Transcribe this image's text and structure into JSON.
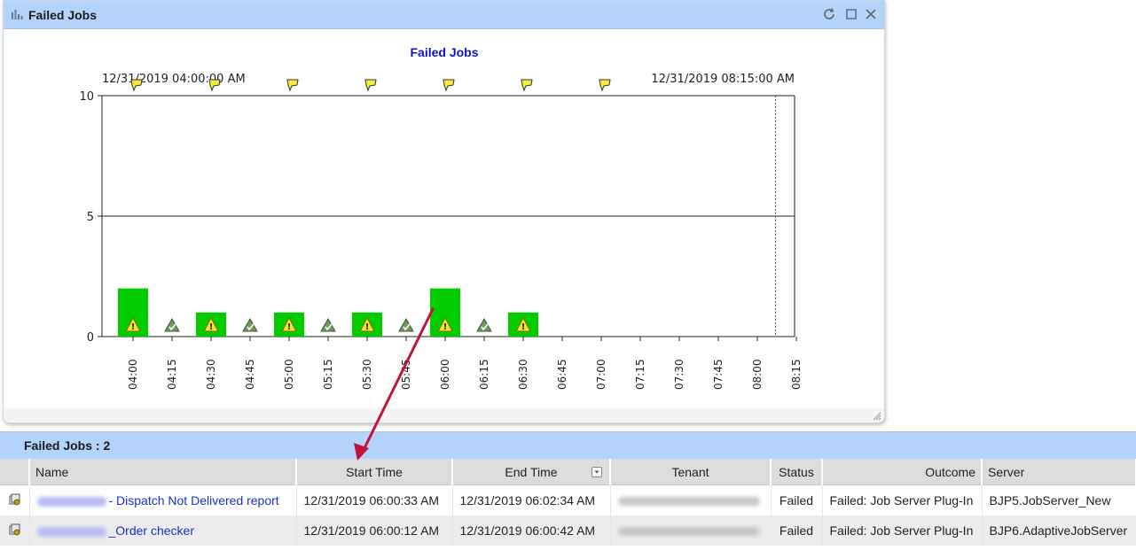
{
  "window": {
    "title": "Failed Jobs"
  },
  "chart_data": {
    "type": "bar",
    "title": "Failed Jobs",
    "start_label": "12/31/2019 04:00:00 AM",
    "end_label": "12/31/2019 08:15:00 AM",
    "ylim": [
      0,
      10
    ],
    "y_ticks": [
      "0",
      "5",
      "10"
    ],
    "categories": [
      "04:00",
      "04:15",
      "04:30",
      "04:45",
      "05:00",
      "05:15",
      "05:30",
      "05:45",
      "06:00",
      "06:15",
      "06:30",
      "06:45",
      "07:00",
      "07:15",
      "07:30",
      "07:45",
      "08:00",
      "08:15"
    ],
    "values": [
      2,
      0,
      1,
      0,
      1,
      0,
      1,
      0,
      2,
      0,
      1,
      0,
      0,
      0,
      0,
      0,
      0,
      0
    ],
    "warning_markers": [
      "04:00",
      "04:30",
      "05:00",
      "05:30",
      "06:00",
      "06:30"
    ],
    "ok_markers": [
      "04:15",
      "04:45",
      "05:15",
      "05:45",
      "06:15"
    ],
    "flag_markers": [
      "04:00",
      "04:30",
      "05:00",
      "05:30",
      "06:00",
      "06:30",
      "07:00"
    ],
    "current_time_marker": "08:07",
    "reference_line": 5,
    "bar_color": "#00cc00"
  },
  "grid": {
    "title": "Failed Jobs : 2",
    "columns": {
      "name": "Name",
      "start": "Start Time",
      "end": "End Time",
      "tenant": "Tenant",
      "status": "Status",
      "outcome": "Outcome",
      "server": "Server"
    },
    "rows": [
      {
        "name": "- Dispatch Not Delivered report",
        "start": "12/31/2019 06:00:33 AM",
        "end": "12/31/2019 06:02:34 AM",
        "status": "Failed",
        "outcome": "Failed: Job Server Plug-In",
        "server": "BJP5.JobServer_New"
      },
      {
        "name": "_Order checker",
        "start": "12/31/2019 06:00:12 AM",
        "end": "12/31/2019 06:00:42 AM",
        "status": "Failed",
        "outcome": "Failed: Job Server Plug-In",
        "server": "BJP6.AdaptiveJobServer"
      }
    ]
  },
  "annotation": {
    "arrow_color": "#c0143c"
  }
}
